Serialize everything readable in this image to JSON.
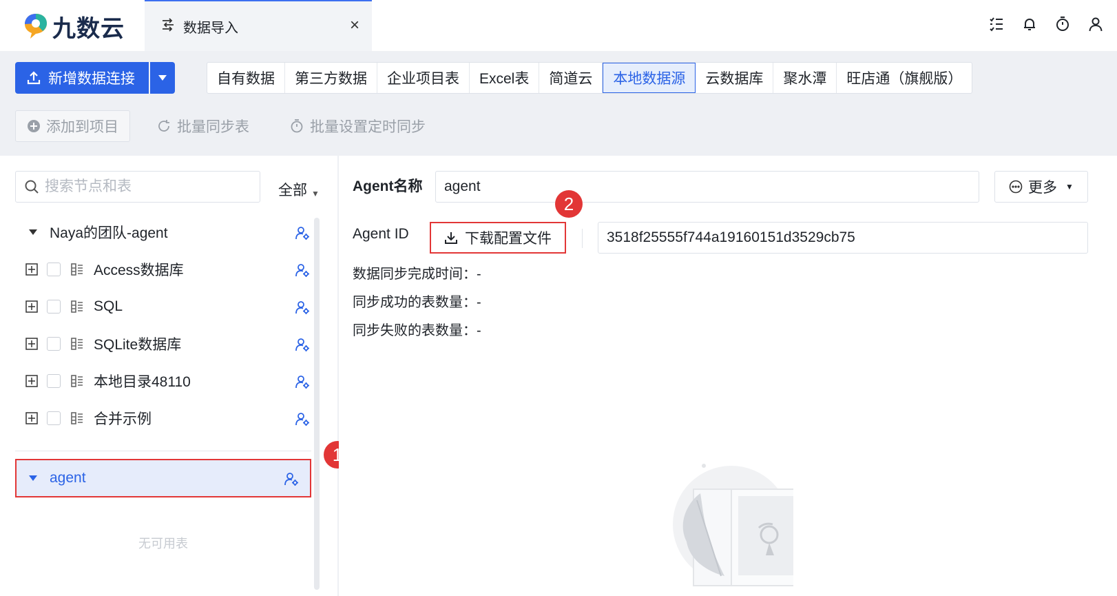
{
  "app": {
    "logo_text": "九数云",
    "tab_label": "数据导入",
    "tab_close": "×",
    "top_icons": [
      "task-list-icon",
      "bell-icon",
      "timer-icon",
      "user-icon"
    ]
  },
  "toolbar": {
    "new_connection_label": "新增数据连接",
    "source_tabs": [
      {
        "label": "自有数据",
        "active": false
      },
      {
        "label": "第三方数据",
        "active": false
      },
      {
        "label": "企业项目表",
        "active": false
      },
      {
        "label": "Excel表",
        "active": false
      },
      {
        "label": "简道云",
        "active": false
      },
      {
        "label": "本地数据源",
        "active": true
      },
      {
        "label": "云数据库",
        "active": false
      },
      {
        "label": "聚水潭",
        "active": false
      },
      {
        "label": "旺店通（旗舰版）",
        "active": false
      }
    ],
    "actions": [
      "添加到项目",
      "批量同步表",
      "批量设置定时同步"
    ]
  },
  "left": {
    "search_placeholder": "搜索节点和表",
    "filter_label": "全部",
    "group_label": "Naya的团队-agent",
    "items": [
      "Access数据库",
      "SQL",
      "SQLite数据库",
      "本地目录48110",
      "合并示例"
    ],
    "agent_label": "agent",
    "empty_text": "无可用表"
  },
  "right": {
    "agent_name_label": "Agent名称",
    "agent_name_value": "agent",
    "more_label": "更多",
    "agent_id_label": "Agent ID",
    "download_label": "下载配置文件",
    "agent_id_value": "3518f25555f744a19160151d3529cb75",
    "stats": [
      "数据同步完成时间：-",
      "同步成功的表数量：-",
      "同步失败的表数量：-"
    ]
  },
  "badges": [
    "1",
    "2"
  ],
  "colors": {
    "primary": "#2b63e6",
    "highlight_red": "#e23636",
    "active_bg": "#e6ecfb"
  }
}
